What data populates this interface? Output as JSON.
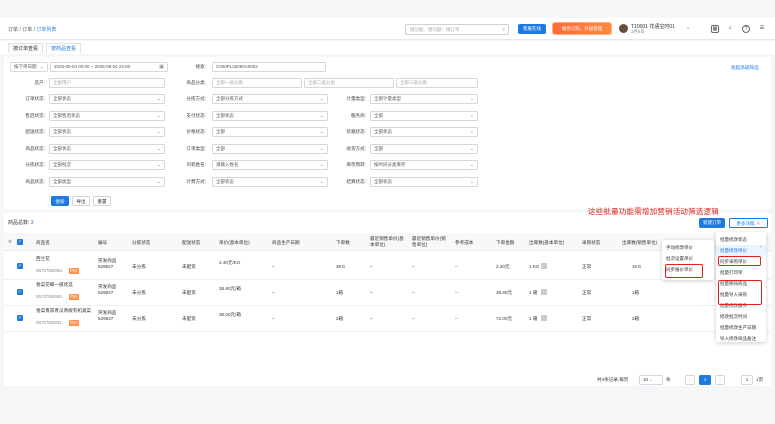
{
  "header": {
    "crumbs": [
      "订单",
      "订单",
      "订单列表"
    ],
    "search_placeholder": "搜功能、搜问题、搜订单",
    "btn_service": "客服在线",
    "btn_promo": "服务订购、升级管理",
    "user_name": "T10001 花语宝时01",
    "user_sub": "3月6日"
  },
  "tabs": [
    "按订单查看",
    "按商品查看"
  ],
  "filters": {
    "date_type": "按下单日期",
    "date_range": "2025-08-04 00:00 ~ 2025-08-04 24:00",
    "search_label": "搜索:",
    "search_value": "C000PL25080A0002",
    "shop_label": "店户:",
    "shop_ph": "全部用户",
    "cat_label": "商品分类:",
    "cat1_ph": "全部一级分类",
    "cat2_ph": "全部二级分类",
    "cat3_ph": "全部三级分类",
    "adv_link": "收起高级筛选",
    "r1": [
      {
        "label": "订单状态:",
        "value": "全部状态"
      },
      {
        "label": "分拣方式:",
        "value": "全部分拣方式"
      },
      {
        "label": "计量类型:",
        "value": "全部计量类型"
      }
    ],
    "r2": [
      {
        "label": "售后状态:",
        "value": "全部售后状态"
      },
      {
        "label": "支付状态:",
        "value": "全部状态"
      },
      {
        "label": "服务商:",
        "value": "全部"
      }
    ],
    "r3": [
      {
        "label": "配送状态:",
        "value": "全部状态"
      },
      {
        "label": "价格状态:",
        "value": "全部"
      },
      {
        "label": "装箱状态:",
        "value": "全部状态"
      }
    ],
    "r4": [
      {
        "label": "商品状态:",
        "value": "全部状态"
      },
      {
        "label": "订单类型:",
        "value": "全部"
      },
      {
        "label": "收货方式:",
        "value": "全部"
      }
    ],
    "r5": [
      {
        "label": "分拣状态:",
        "value": "全部批次"
      },
      {
        "label": "司机姓名:",
        "value": "请输入姓名"
      },
      {
        "label": "库存周转:",
        "value": "按时间分类库存"
      }
    ],
    "r6": [
      {
        "label": "商品状态:",
        "value": "全部类型"
      },
      {
        "label": "计费方式:",
        "value": "全部状态"
      },
      {
        "label": "结算状态:",
        "value": "全部状态"
      }
    ],
    "btn_search": "搜索",
    "btn_export": "导出",
    "btn_reset": "重置"
  },
  "list": {
    "count_label": "商品总数:",
    "count": "3",
    "btn_new": "新建订单",
    "btn_more": "更多功能 ∧"
  },
  "annotation": "这些批量功能需增加营销活动筛选逻辑",
  "columns": [
    "商品名",
    "编号",
    "分拣状态",
    "配送状态",
    "单价(基本单位)",
    "商品生产日期",
    "下单数",
    "最近销售单价(基本单位)",
    "最近销售单价(销售单位)",
    "参考成本",
    "下单金额",
    "出库数(基本单位)",
    "采购状态",
    "出库数(销售单位)"
  ],
  "rows": [
    {
      "name": "西兰花",
      "code": "D5727692961",
      "tag": "特价",
      "no": "突发商品529627",
      "sort": "未分拣",
      "dist": "未配货",
      "price": "2.40元/KG",
      "date": "–",
      "qty": "3KG",
      "a": "–",
      "b": "–",
      "c": "–",
      "amount": "2.40元",
      "out": "1 KG",
      "buy": "正常",
      "out2": "1KG"
    },
    {
      "name": "春菜花椰一级优选",
      "code": "D5727692851",
      "tag": "特价",
      "no": "突发商品529627",
      "sort": "未分拣",
      "dist": "未配货",
      "price": "38.90元/箱",
      "date": "–",
      "qty": "1箱",
      "a": "–",
      "b": "–",
      "c": "–",
      "amount": "38.90元",
      "out": "1 箱",
      "buy": "正常",
      "out2": "1箱"
    },
    {
      "name": "香菜青蒜青瓜青椒有机蔬菜",
      "code": "D5727692811",
      "tag": "特价",
      "no": "突发商品529627",
      "sort": "未分拣",
      "dist": "未配货",
      "price": "36.00元/箱",
      "date": "–",
      "qty": "2箱",
      "a": "–",
      "b": "–",
      "c": "–",
      "amount": "72.00元",
      "out": "1 箱",
      "buy": "正常",
      "out2": "2箱"
    }
  ],
  "menu_main": [
    "批量修改状态",
    "批量修改单价",
    "同步采购单价",
    "批量打印单",
    "批量移除商品",
    "批量导入采购",
    "批量修改服务",
    "修改批次时间",
    "批量修改生产日期",
    "导入修改商品备注"
  ],
  "menu_sub": [
    "手动修改单价",
    "批次设置单价",
    "同步报价单价"
  ],
  "pager": {
    "summary": "共3条记录,每页",
    "size": "10",
    "unit": "条",
    "page": "1",
    "goto": "1",
    "goto_unit": "1页"
  }
}
